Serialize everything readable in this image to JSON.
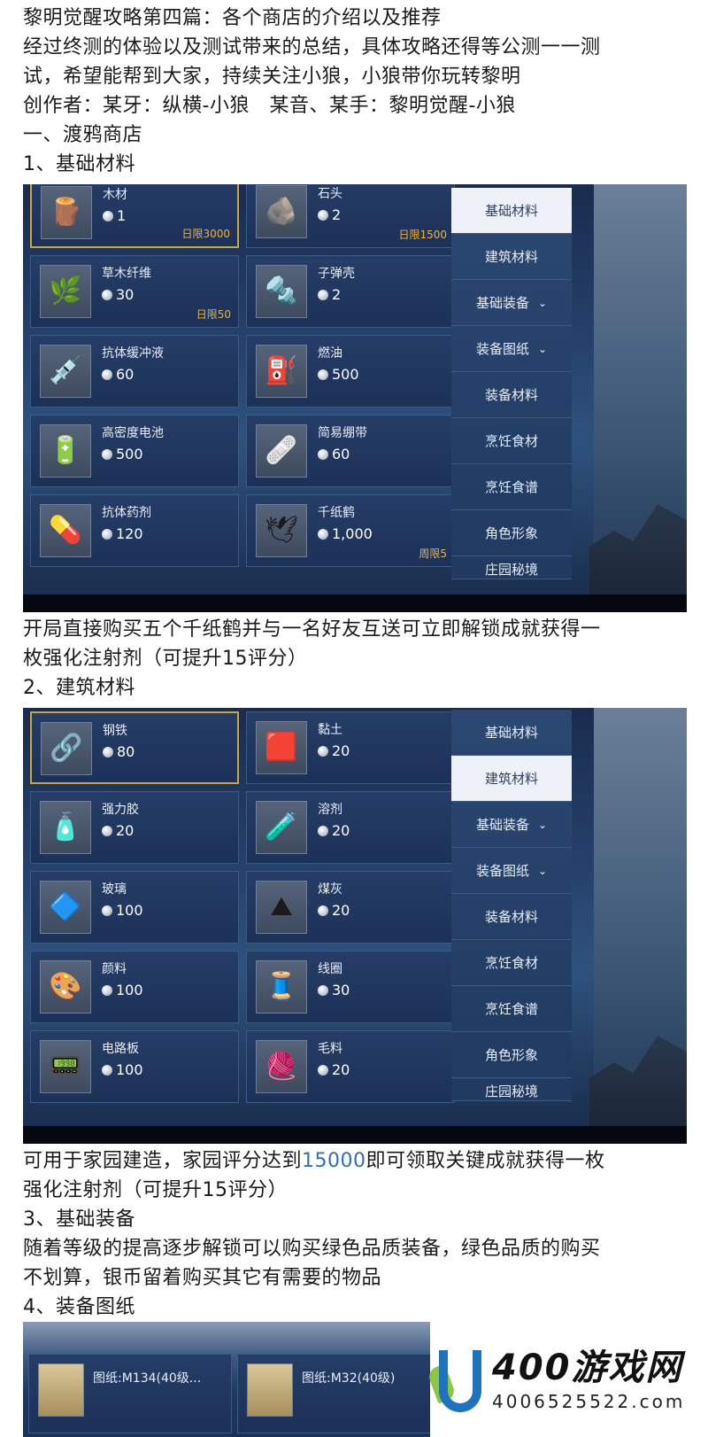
{
  "intro": {
    "line1": "黎明觉醒攻略第四篇：各个商店的介绍以及推荐",
    "line2": "经过终测的体验以及测试带来的总结，具体攻略还得等公测一一测",
    "line3": "试，希望能帮到大家，持续关注小狼，小狼带你玩转黎明",
    "line4": "创作者：某牙：纵横-小狼　某音、某手：黎明觉醒-小狼",
    "line5": "一、渡鸦商店",
    "line6": "1、基础材料"
  },
  "menu": {
    "items": [
      "基础材料",
      "建筑材料",
      "基础装备",
      "装备图纸",
      "装备材料",
      "烹饪食材",
      "烹饪食谱",
      "角色形象",
      "庄园秘境"
    ],
    "chevron": "⌄"
  },
  "shop1": {
    "items": [
      {
        "name": "木材",
        "price": "1",
        "limit": "日限3000",
        "icon": "wood-icon",
        "glyph": "🪵"
      },
      {
        "name": "石头",
        "price": "2",
        "limit": "日限1500",
        "icon": "stone-icon",
        "glyph": "🪨"
      },
      {
        "name": "草木纤维",
        "price": "30",
        "limit": "日限50",
        "icon": "plant-fiber-icon",
        "glyph": "🌿"
      },
      {
        "name": "子弹壳",
        "price": "2",
        "limit": "",
        "icon": "bullet-shell-icon",
        "glyph": "🔩"
      },
      {
        "name": "抗体缓冲液",
        "price": "60",
        "limit": "",
        "icon": "syringe-icon",
        "glyph": "💉"
      },
      {
        "name": "燃油",
        "price": "500",
        "limit": "",
        "icon": "fuel-can-icon",
        "glyph": "⛽"
      },
      {
        "name": "高密度电池",
        "price": "500",
        "limit": "",
        "icon": "battery-icon",
        "glyph": "🔋"
      },
      {
        "name": "简易绷带",
        "price": "60",
        "limit": "",
        "icon": "bandage-icon",
        "glyph": "🩹"
      },
      {
        "name": "抗体药剂",
        "price": "120",
        "limit": "",
        "icon": "medicine-bottle-icon",
        "glyph": "💊"
      },
      {
        "name": "千纸鹤",
        "price": "1,000",
        "limit": "周限5",
        "icon": "paper-crane-icon",
        "glyph": "🕊"
      }
    ]
  },
  "between1": {
    "line1": "开局直接购买五个千纸鹤并与一名好友互送可立即解锁成就获得一",
    "line2": "枚强化注射剂（可提升15评分）",
    "line3": "2、建筑材料"
  },
  "shop2": {
    "items": [
      {
        "name": "钢铁",
        "price": "80",
        "icon": "steel-icon",
        "glyph": "🔗"
      },
      {
        "name": "黏土",
        "price": "20",
        "icon": "clay-icon",
        "glyph": "🟥"
      },
      {
        "name": "强力胶",
        "price": "20",
        "icon": "glue-icon",
        "glyph": "🧴"
      },
      {
        "name": "溶剂",
        "price": "20",
        "icon": "solvent-icon",
        "glyph": "🧪"
      },
      {
        "name": "玻璃",
        "price": "100",
        "icon": "glass-icon",
        "glyph": "🔷"
      },
      {
        "name": "煤灰",
        "price": "20",
        "icon": "coal-ash-icon",
        "glyph": "⛰"
      },
      {
        "name": "颜料",
        "price": "100",
        "icon": "paint-icon",
        "glyph": "🎨"
      },
      {
        "name": "线圈",
        "price": "30",
        "icon": "coil-icon",
        "glyph": "🧵"
      },
      {
        "name": "电路板",
        "price": "100",
        "icon": "circuit-board-icon",
        "glyph": "📟"
      },
      {
        "name": "毛料",
        "price": "20",
        "icon": "wool-icon",
        "glyph": "🧶"
      }
    ]
  },
  "between2": {
    "line1_a": "可用于家园建造，家园评分达到",
    "line1_hl": "15000",
    "line1_b": "即可领取关键成就获得一枚",
    "line2": "强化注射剂（可提升15评分）",
    "line3": "3、基础装备",
    "line4": "随着等级的提高逐步解锁可以购买绿色品质装备，绿色品质的购买",
    "line5": "不划算，银币留着购买其它有需要的物品",
    "line6": "4、装备图纸"
  },
  "shop3": {
    "items": [
      {
        "name": "图纸:M134(40级..."
      },
      {
        "name": "图纸:M32(40级)"
      }
    ]
  },
  "watermark": {
    "brand": "400游戏网",
    "phone": "4006525522.com"
  },
  "colors": {
    "highlight": "#2e6fb7",
    "limit": "#f0b23a",
    "panel": "#1c3158"
  }
}
